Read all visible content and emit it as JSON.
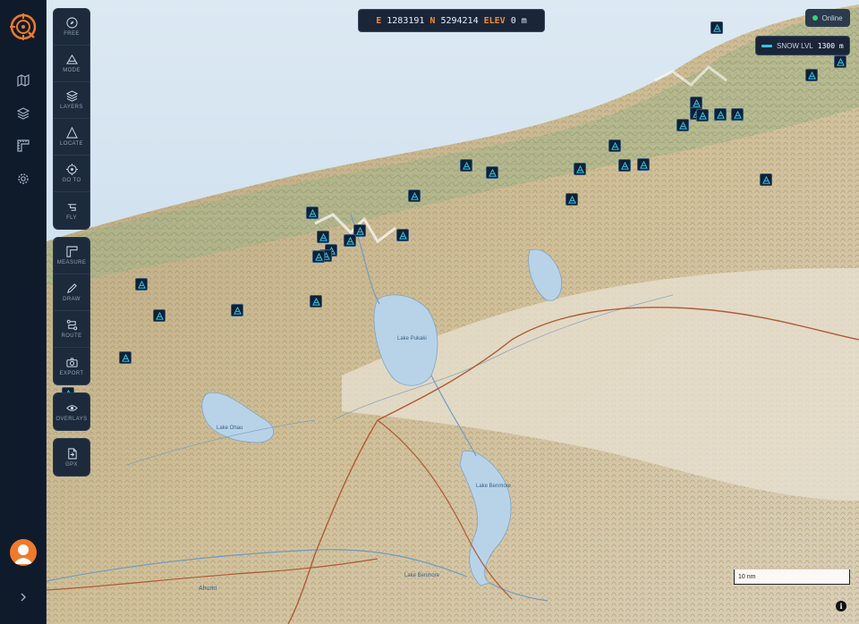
{
  "coords": {
    "e_label": "E",
    "e_value": "1283191",
    "n_label": "N",
    "n_value": "5294214",
    "elev_label": "ELEV",
    "elev_value": "0 m"
  },
  "status": {
    "online_label": "Online"
  },
  "snow": {
    "label": "SNOW LVL",
    "value": "1300 m"
  },
  "tools": {
    "free": "FREE",
    "mode": "MODE",
    "layers": "LAYERS",
    "locate": "LOCATE",
    "goto": "GO TO",
    "fly": "FLY",
    "measure": "MEASURE",
    "draw": "DRAW",
    "route": "ROUTE",
    "export": "EXPORT",
    "overlays": "OVERLAYS",
    "gpx": "GPX"
  },
  "scale": {
    "label": "10 nm"
  },
  "map_labels": {
    "lake1": "Lake Pukaki",
    "lake2": "Lake Ohau",
    "lake3": "Lake Benmore",
    "lake4": "Lake Benmore",
    "river": "Ahuriri"
  },
  "colors": {
    "accent": "#f0893a",
    "panel": "#1c2a3c",
    "peak_icon": "#2fc6e8"
  }
}
